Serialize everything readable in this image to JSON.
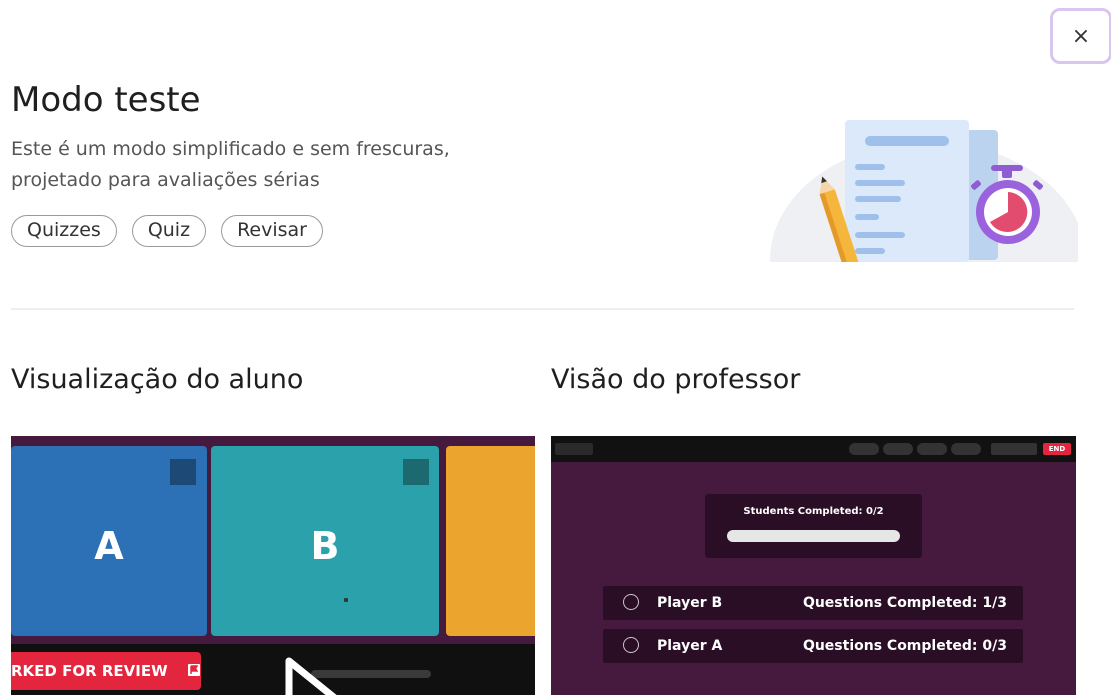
{
  "dialog": {
    "close_symbol": "×",
    "title": "Modo teste",
    "description": "Este é um modo simplificado e sem frescuras, projetado para avaliações sérias",
    "tags": [
      "Quizzes",
      "Quiz",
      "Revisar"
    ]
  },
  "student_view": {
    "heading": "Visualização do aluno",
    "options": [
      "A",
      "B"
    ],
    "review_button": "RKED FOR REVIEW"
  },
  "teacher_view": {
    "heading": "Visão do professor",
    "end_button": "END",
    "students_completed": "Students Completed: 0/2",
    "players": [
      {
        "name": "Player B",
        "progress": "Questions Completed: 1/3"
      },
      {
        "name": "Player A",
        "progress": "Questions Completed: 0/3"
      }
    ]
  },
  "colors": {
    "option_a": "#2c70b6",
    "option_b": "#2ba2ab",
    "option_c": "#eba52e",
    "preview_bg": "#461a3e",
    "review_red": "#e3263e",
    "close_border": "#d9c6ef"
  },
  "icons": [
    "close-icon",
    "document-illustration",
    "pencil-icon",
    "stopwatch-icon",
    "flag-icon",
    "play-icon"
  ]
}
